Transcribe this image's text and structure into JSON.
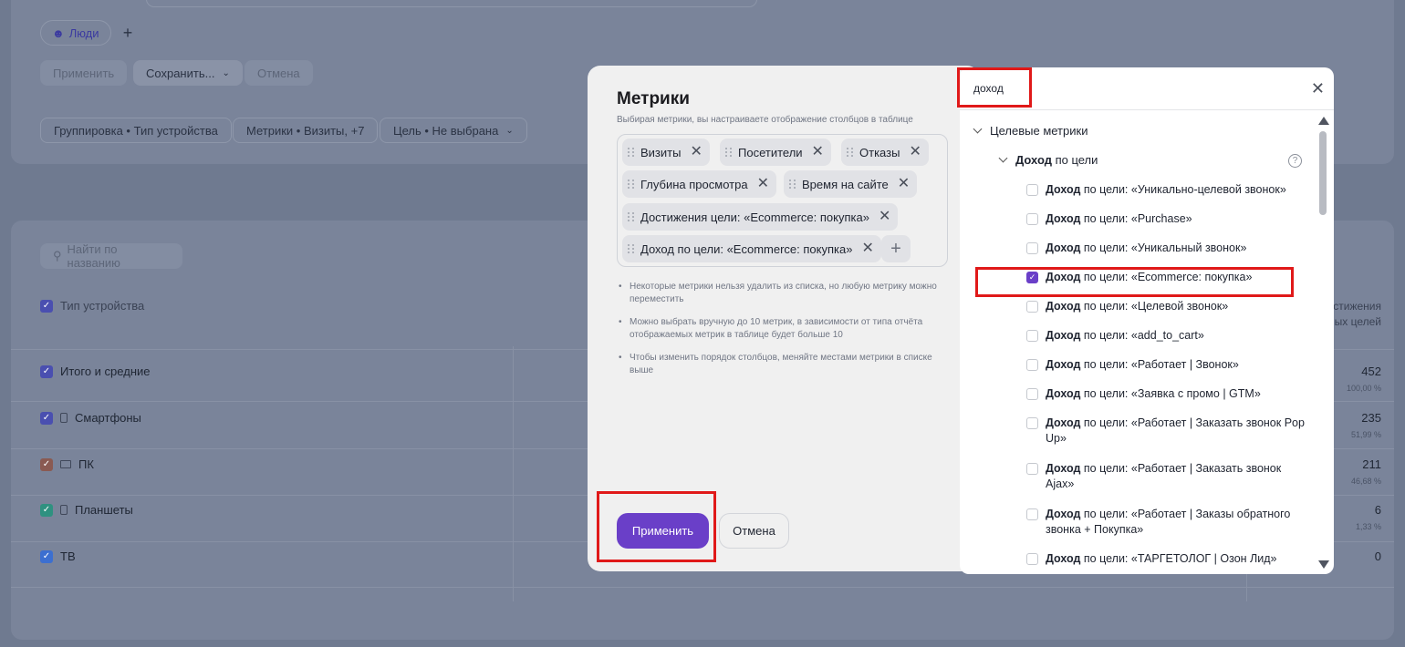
{
  "background": {
    "people_label": "Люди",
    "apply_label": "Применить",
    "save_label": "Сохранить...",
    "cancel_label": "Отмена",
    "grouping_label": "Группировка • Тип устройства",
    "metrics_label": "Метрики • Визиты, +7",
    "goal_label": "Цель • Не выбрана",
    "search_placeholder": "Найти по названию",
    "column_header": "Тип устройства",
    "right_header": "стижения\nых целей",
    "rows": [
      {
        "label": "Итого и средние",
        "value": "452",
        "pct": "100,00 %"
      },
      {
        "label": "Смартфоны",
        "value": "235",
        "pct": "51,99 %"
      },
      {
        "label": "ПК",
        "value": "211",
        "pct": "46,68 %"
      },
      {
        "label": "Планшеты",
        "value": "6",
        "pct": "1,33 %"
      },
      {
        "label": "ТВ",
        "value": "0",
        "pct": ""
      }
    ]
  },
  "metrics_dialog": {
    "title": "Метрики",
    "subtitle": "Выбирая метрики, вы настраиваете отображение столбцов в таблице",
    "tags": [
      "Визиты",
      "Посетители",
      "Отказы",
      "Глубина просмотра",
      "Время на сайте",
      "Достижения цели: «Ecommerce: покупка»",
      "Доход по цели: «Ecommerce: покупка»"
    ],
    "notes": [
      "Некоторые метрики нельзя удалить из списка, но любую метрику можно переместить",
      "Можно выбрать вручную до 10 метрик, в зависимости от типа отчёта отображаемых метрик в таблице будет больше 10",
      "Чтобы изменить порядок столбцов, меняйте местами метрики в списке выше"
    ],
    "apply_label": "Применить",
    "cancel_label": "Отмена"
  },
  "dropdown": {
    "search_value": "доход",
    "group_label": "Целевые метрики",
    "sub_bold": "Доход",
    "sub_rest": " по цели",
    "help_icon": "?",
    "options": [
      {
        "bold": "Доход",
        "rest": " по цели: «Уникально-целевой звонок»",
        "checked": false
      },
      {
        "bold": "Доход",
        "rest": " по цели: «Purchase»",
        "checked": false
      },
      {
        "bold": "Доход",
        "rest": " по цели: «Уникальный звонок»",
        "checked": false
      },
      {
        "bold": "Доход",
        "rest": " по цели: «Ecommerce: покупка»",
        "checked": true
      },
      {
        "bold": "Доход",
        "rest": " по цели: «Целевой звонок»",
        "checked": false
      },
      {
        "bold": "Доход",
        "rest": " по цели: «add_to_cart»",
        "checked": false
      },
      {
        "bold": "Доход",
        "rest": " по цели: «Работает | Звонок»",
        "checked": false
      },
      {
        "bold": "Доход",
        "rest": " по цели: «Заявка с промо | GTM»",
        "checked": false
      },
      {
        "bold": "Доход",
        "rest": " по цели: «Работает | Заказать звонок Pop Up»",
        "checked": false
      },
      {
        "bold": "Доход",
        "rest": " по цели: «Работает | Заказать звонок Ajax»",
        "checked": false
      },
      {
        "bold": "Доход",
        "rest": " по цели: «Работает | Заказы обратного звонка + Покупка»",
        "checked": false
      },
      {
        "bold": "Доход",
        "rest": " по цели: «ТАРГЕТОЛОГ | Озон Лид»",
        "checked": false
      }
    ]
  },
  "colors": {
    "accent": "#6a3fc8",
    "highlight": "#e01919",
    "overlay": "#6f7a90"
  }
}
